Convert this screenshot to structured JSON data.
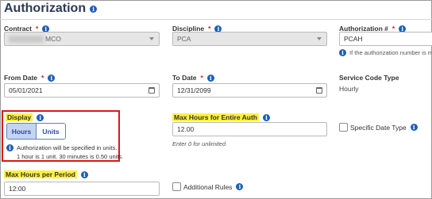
{
  "title": "Authorization",
  "contract": {
    "label": "Contract",
    "value": "MCO"
  },
  "discipline": {
    "label": "Discipline",
    "value": "PCA"
  },
  "authorization_number": {
    "label": "Authorization #",
    "value": "PCAH",
    "hint": "If the authorization number is m"
  },
  "from_date": {
    "label": "From Date",
    "value": "05/01/2021"
  },
  "to_date": {
    "label": "To Date",
    "value": "12/31/2099"
  },
  "service_code_type": {
    "label": "Service Code Type",
    "value": "Hourly"
  },
  "display": {
    "label": "Display",
    "options": [
      "Hours",
      "Units"
    ],
    "selected": "Hours",
    "note_line1": "Authorization will be specified in units.",
    "note_line2": "1 hour is 1 unit. 30 minutes is 0.50 units."
  },
  "max_hours_entire_auth": {
    "label": "Max Hours for Entire Auth",
    "value": "12.00",
    "hint": "Enter 0 for unlimited"
  },
  "specific_date_type": {
    "label": "Specific Date Type"
  },
  "max_hours_per_period": {
    "label": "Max Hours per Period",
    "value": "12:00"
  },
  "additional_rules": {
    "label": "Additional Rules"
  },
  "required_mark": "*",
  "info_glyph": "i",
  "colors": {
    "highlight": "#fff23a",
    "annotation_box": "#e0141b",
    "info": "#1e5eb8",
    "required": "#d01a1a"
  }
}
